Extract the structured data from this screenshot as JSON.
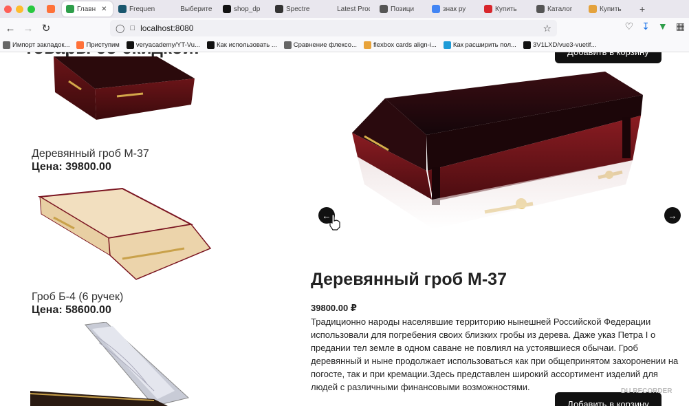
{
  "browser": {
    "tabs": [
      {
        "label": "",
        "icon": "firefox-icon",
        "color": "#ff7139"
      },
      {
        "label": "Главн",
        "icon": "play-icon",
        "color": "#2e9e4a",
        "active": true
      },
      {
        "label": "Frequen",
        "icon": "editor-icon",
        "color": "#19566e"
      },
      {
        "label": "Выберите П",
        "icon": "",
        "color": ""
      },
      {
        "label": "shop_dp",
        "icon": "github-icon",
        "color": "#111"
      },
      {
        "label": "Spectre",
        "icon": "spectre-icon",
        "color": "#333"
      },
      {
        "label": "Latest Produ",
        "icon": "",
        "color": ""
      },
      {
        "label": "Позици",
        "icon": "gmail-icon",
        "color": "#555"
      },
      {
        "label": "знак ру",
        "icon": "google-icon",
        "color": "#4285f4"
      },
      {
        "label": "Купить",
        "icon": "shop-icon",
        "color": "#d8262c"
      },
      {
        "label": "Каталог",
        "icon": "catalog-icon",
        "color": "#555"
      },
      {
        "label": "Купить",
        "icon": "shop-icon-2",
        "color": "#e4a23c"
      }
    ],
    "new_tab": "+",
    "url": "localhost:8080",
    "bookmarks": [
      {
        "label": "Импорт закладок...",
        "color": "#666"
      },
      {
        "label": "Приступим",
        "color": "#ff7139"
      },
      {
        "label": "veryacademy/YT-Vu...",
        "color": "#111"
      },
      {
        "label": "Как использовать ...",
        "color": "#111"
      },
      {
        "label": "Сравнение флексо...",
        "color": "#666"
      },
      {
        "label": "flexbox cards align-i...",
        "color": "#e8a33a"
      },
      {
        "label": "Как расширить пол...",
        "color": "#1e9bd7"
      },
      {
        "label": "3V1LXD/vue3-vuetif...",
        "color": "#111"
      }
    ]
  },
  "page": {
    "section_title": "Товары со скидкой!",
    "cart_button_top": "Добавить в корзину",
    "list": [
      {
        "name": "Деревянный гроб М-37",
        "price_label": "Цена: 39800.00"
      },
      {
        "name": "Гроб Б-4 (6 ручек)",
        "price_label": "Цена: 58600.00"
      }
    ],
    "detail": {
      "title": "Деревянный гроб М-37",
      "price": "39800.00 ₽",
      "description": "Традиционно народы населявшие территорию нынешней Российской Федерации использовали для погребения своих близких гробы из дерева. Даже указ Петра I о предании тел земле в одном саване не повлиял на устоявшиеся обычаи. Гроб деревянный и ныне продолжает использоваться как при общепринятом захоронении на погосте, так и при кремации.Здесь представлен широкий ассортимент изделий для людей с различными финансовыми возможностями.",
      "cart_button": "Добавить в корзину"
    },
    "watermark": "DU RECORDER"
  }
}
